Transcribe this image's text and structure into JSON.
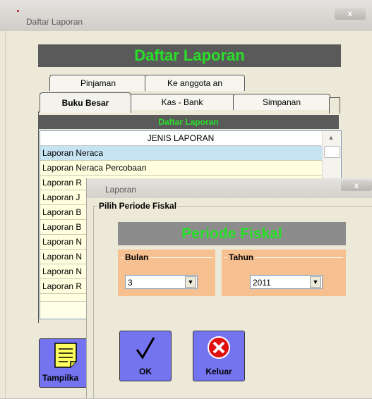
{
  "main_window": {
    "title": "Daftar Laporan",
    "close_label": "x",
    "banner": "Daftar Laporan",
    "tabs": {
      "row1": [
        "Pinjaman",
        "Ke anggota an"
      ],
      "row2": [
        "Buku Besar",
        "Kas - Bank",
        "Simpanan"
      ],
      "active": "Buku Besar"
    },
    "sub_banner": "Daftar Laporan",
    "list": {
      "header": "JENIS LAPORAN",
      "rows": [
        "Laporan Neraca",
        "Laporan Neraca Percobaan",
        "Laporan R",
        "Laporan J",
        "Laporan B",
        "Laporan B",
        "Laporan N",
        "Laporan N",
        "Laporan N",
        "Laporan R"
      ],
      "selected_index": 0
    },
    "tampilkan_label": "Tampilka"
  },
  "dialog": {
    "title": "Laporan",
    "close_label": "x",
    "group_label": "Pilih Periode Fiskal",
    "banner": "Periode Fiskal",
    "bulan": {
      "label": "Bulan",
      "value": "3"
    },
    "tahun": {
      "label": "Tahun",
      "value": "2011"
    },
    "ok_label": "OK",
    "keluar_label": "Keluar"
  },
  "colors": {
    "banner_text": "#28e028",
    "button_bg": "#7474f0",
    "panel_bg": "#f6c090",
    "selected_row": "#c6e3f2"
  },
  "icons": [
    "note-icon",
    "checkmark-icon",
    "close-circle-icon",
    "chevron-down-icon"
  ]
}
